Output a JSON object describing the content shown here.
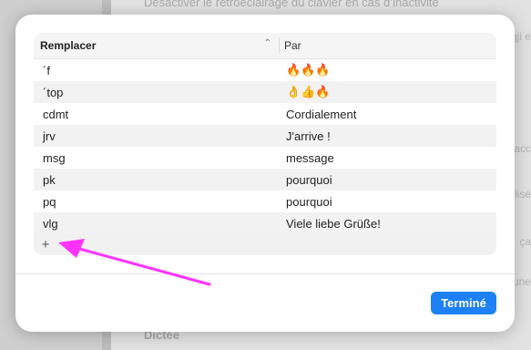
{
  "background": {
    "top_text": "Désactiver le rétroéclairage du clavier en cas d’inactivité",
    "bottom_text": "Dictée",
    "right_fragments": [
      "gji e",
      "acc",
      "lisé",
      "ça",
      "une"
    ]
  },
  "table": {
    "header": {
      "replace": "Remplacer",
      "with": "Par"
    },
    "rows": [
      {
        "replace": "´f",
        "with": "🔥🔥🔥"
      },
      {
        "replace": "´top",
        "with": "👌👍🔥"
      },
      {
        "replace": "cdmt",
        "with": "Cordialement"
      },
      {
        "replace": "jrv",
        "with": "J'arrive !"
      },
      {
        "replace": "msg",
        "with": "message"
      },
      {
        "replace": "pk",
        "with": "pourquoi"
      },
      {
        "replace": "pq",
        "with": "pourquoi"
      },
      {
        "replace": "vlg",
        "with": "Viele liebe Grüße!"
      }
    ],
    "add_label": "+"
  },
  "done_label": "Terminé",
  "colors": {
    "accent": "#1d80f5",
    "annotation": "#ff33ff"
  },
  "icons": {
    "sort": "chevron-up-icon",
    "add": "plus-icon"
  }
}
